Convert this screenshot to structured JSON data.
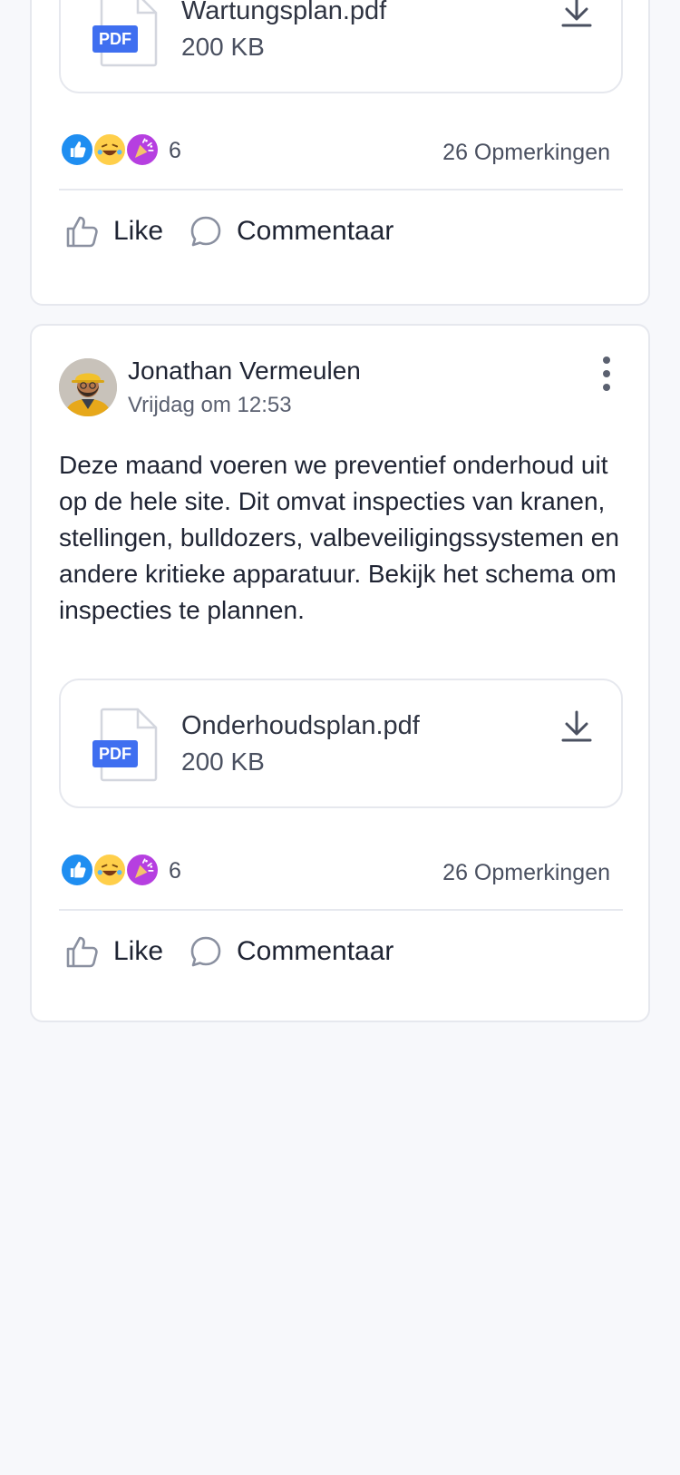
{
  "posts": [
    {
      "attachment": {
        "name": "Wartungsplan.pdf",
        "size": "200 KB",
        "badge": "PDF"
      },
      "reactions": {
        "count": "6",
        "comments": "26 Opmerkingen"
      },
      "actions": {
        "like": "Like",
        "comment": "Commentaar"
      }
    },
    {
      "author": "Jonathan Vermeulen",
      "timestamp": "Vrijdag om 12:53",
      "text": "Deze maand voeren we preventief onderhoud uit op de hele site. Dit omvat inspecties van kranen, stellingen, bulldozers, valbeveiligingssystemen en andere kritieke apparatuur. Bekijk het schema om inspecties te plannen.",
      "attachment": {
        "name": "Onderhoudsplan.pdf",
        "size": "200 KB",
        "badge": "PDF"
      },
      "reactions": {
        "count": "6",
        "comments": "26 Opmerkingen"
      },
      "actions": {
        "like": "Like",
        "comment": "Commentaar"
      }
    }
  ],
  "colors": {
    "pdf_badge": "#3f6ff0",
    "like": "#1f8ef1",
    "laugh": "#ffcf4a",
    "party": "#b63fe0"
  },
  "icons": [
    "pdf-file-icon",
    "download-icon",
    "thumbs-up-icon",
    "laughing-emoji-icon",
    "party-popper-icon",
    "speech-bubble-icon",
    "more-vertical-icon"
  ]
}
